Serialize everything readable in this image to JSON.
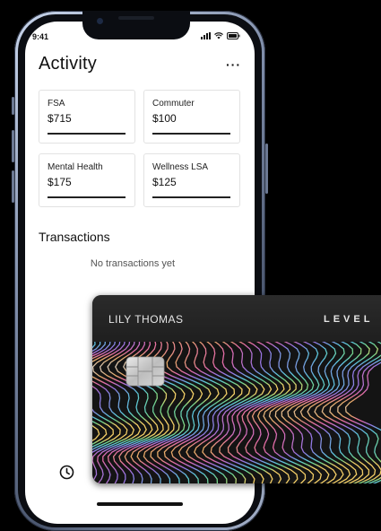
{
  "status": {
    "time": "9:41"
  },
  "header": {
    "title": "Activity",
    "more_label": "···"
  },
  "accounts": [
    {
      "label": "FSA",
      "value": "$715"
    },
    {
      "label": "Commuter",
      "value": "$100"
    },
    {
      "label": "Mental Health",
      "value": "$175"
    },
    {
      "label": "Wellness LSA",
      "value": "$125"
    }
  ],
  "transactions": {
    "title": "Transactions",
    "empty_text": "No transactions yet"
  },
  "card": {
    "holder_name": "LILY THOMAS",
    "brand": "LEVEL"
  },
  "icons": {
    "status": [
      "signal-icon",
      "wifi-icon",
      "battery-icon"
    ],
    "nav": [
      "clock-icon"
    ],
    "card": [
      "chip-icon"
    ]
  },
  "colors": {
    "background": "#000000",
    "screen": "#ffffff",
    "card": "#141414",
    "frame": "#8a97b0"
  }
}
